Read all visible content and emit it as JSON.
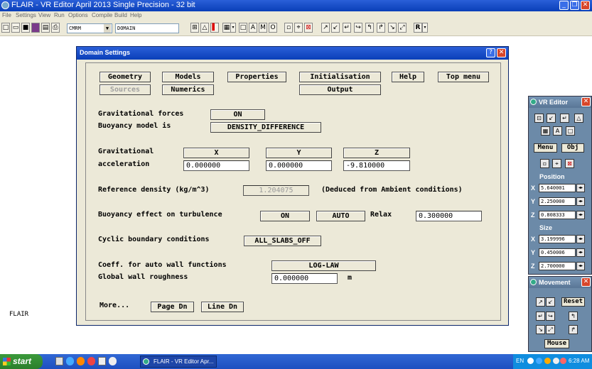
{
  "window": {
    "title": "FLAIR - VR Editor April 2013 Single Precision - 32 bit"
  },
  "menu": [
    "File",
    "Settings",
    "View",
    "Run",
    "Options",
    "Compile",
    "Build",
    "Help"
  ],
  "toolbar": {
    "object_combo": "CMRM",
    "domain_field": "DOMAIN",
    "r_button": "R"
  },
  "desktop_label": "FLAIR",
  "dialog": {
    "title": "Domain Settings",
    "nav": {
      "geometry": "Geometry",
      "models": "Models",
      "properties": "Properties",
      "initialisation": "Initialisation",
      "help": "Help",
      "top_menu": "Top menu",
      "sources": "Sources",
      "numerics": "Numerics",
      "output": "Output"
    },
    "gravity": {
      "forces_label": "Gravitational forces",
      "forces_value": "ON",
      "buoyancy_label": "Buoyancy model is",
      "buoyancy_value": "DENSITY_DIFFERENCE"
    },
    "acceleration": {
      "label1": "Gravitational",
      "label2": "acceleration",
      "x_label": "X",
      "y_label": "Y",
      "z_label": "Z",
      "x_value": "0.000000",
      "y_value": "0.000000",
      "z_value": "-9.810000"
    },
    "reference": {
      "label": "Reference density (kg/m^3)",
      "value": "1.204075",
      "note": "(Deduced from Ambient conditions)"
    },
    "turbulence": {
      "label": "Buoyancy effect on turbulence",
      "on": "ON",
      "auto": "AUTO",
      "relax_label": "Relax",
      "relax_value": "0.300000"
    },
    "cyclic": {
      "label": "Cyclic boundary conditions",
      "value": "ALL_SLABS_OFF"
    },
    "wall": {
      "coeff_label": "Coeff. for auto wall functions",
      "coeff_value": "LOG-LAW",
      "rough_label": "Global wall roughness",
      "rough_value": "0.000000",
      "unit": "m"
    },
    "footer": {
      "more": "More...",
      "page_dn": "Page Dn",
      "line_dn": "Line Dn"
    }
  },
  "vr_editor": {
    "title": "VR Editor",
    "menu_btn": "Menu",
    "obj_btn": "Obj",
    "position_label": "Position",
    "size_label": "Size",
    "position": {
      "x": "5.640001",
      "y": "2.250000",
      "z": "0.808333"
    },
    "size": {
      "x": "3.199996",
      "y": "0.450006",
      "z": "2.700000"
    },
    "axis": {
      "x": "X",
      "y": "Y",
      "z": "Z"
    }
  },
  "movement": {
    "title": "Movement",
    "reset": "Reset",
    "mouse": "Mouse"
  },
  "taskbar": {
    "start": "start",
    "task": "FLAIR - VR Editor Apr...",
    "lang": "EN",
    "time": "6:28 AM"
  },
  "colors": {
    "titlebar": "#0a3fb8",
    "dialog_bg": "#ece9d8",
    "vr_bg": "#6c8aa8",
    "taskbar": "#245edb",
    "start": "#2b7f2b"
  }
}
